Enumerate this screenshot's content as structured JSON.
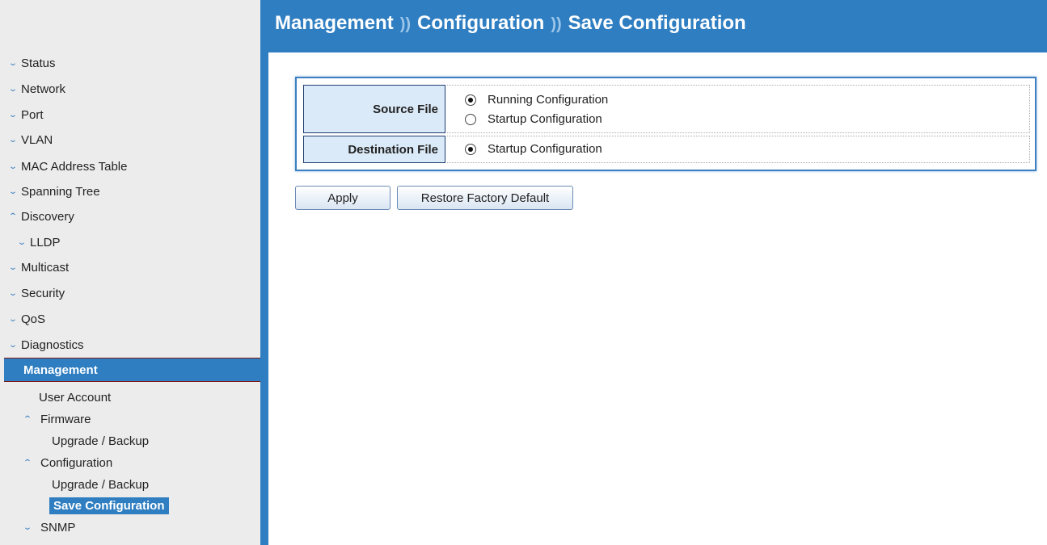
{
  "header": {
    "breadcrumb": [
      "Management",
      "Configuration",
      "Save Configuration"
    ],
    "separator": "))"
  },
  "sidebar": {
    "items": [
      {
        "label": "Status",
        "chevron": "down"
      },
      {
        "label": "Network",
        "chevron": "down"
      },
      {
        "label": "Port",
        "chevron": "down"
      },
      {
        "label": "VLAN",
        "chevron": "down"
      },
      {
        "label": "MAC Address Table",
        "chevron": "down"
      },
      {
        "label": "Spanning Tree",
        "chevron": "down"
      },
      {
        "label": "Discovery",
        "chevron": "up"
      },
      {
        "label": "LLDP",
        "chevron": "down"
      },
      {
        "label": "Multicast",
        "chevron": "down"
      },
      {
        "label": "Security",
        "chevron": "down"
      },
      {
        "label": "QoS",
        "chevron": "down"
      },
      {
        "label": "Diagnostics",
        "chevron": "down"
      },
      {
        "label": "Management",
        "active": true
      },
      {
        "label": "User Account"
      },
      {
        "label": "Firmware",
        "chevron": "up"
      },
      {
        "label": "Upgrade / Backup"
      },
      {
        "label": "Configuration",
        "chevron": "up"
      },
      {
        "label": "Upgrade / Backup"
      },
      {
        "label": "Save Configuration",
        "selected": true
      },
      {
        "label": "SNMP",
        "chevron": "down"
      }
    ]
  },
  "form": {
    "source_label": "Source File",
    "source_options": [
      {
        "label": "Running Configuration",
        "checked": true
      },
      {
        "label": "Startup Configuration",
        "checked": false
      }
    ],
    "destination_label": "Destination File",
    "destination_options": [
      {
        "label": "Startup Configuration",
        "checked": true
      }
    ]
  },
  "buttons": {
    "apply": "Apply",
    "restore": "Restore Factory Default"
  },
  "colors": {
    "accent": "#2f7ec1",
    "label_bg": "#dbeaf8",
    "sidebar_bg": "#ececec"
  }
}
